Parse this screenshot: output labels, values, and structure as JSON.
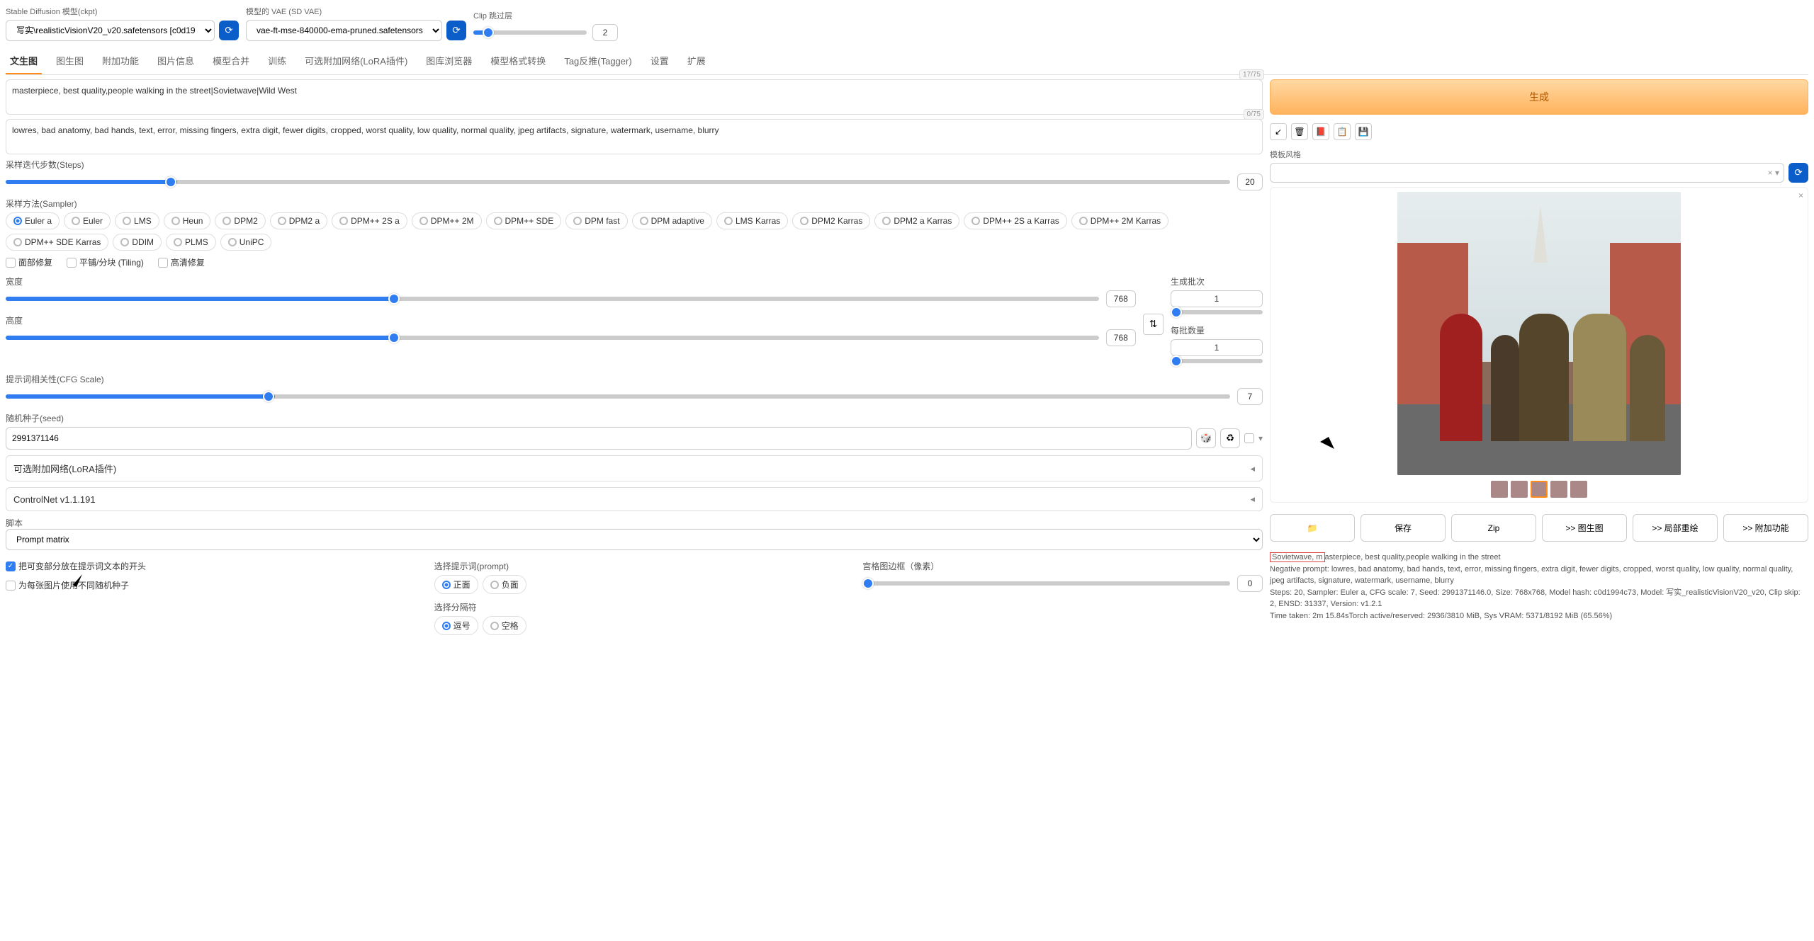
{
  "top": {
    "model_label": "Stable Diffusion 模型(ckpt)",
    "model_value": "写实\\realisticVisionV20_v20.safetensors [c0d19",
    "vae_label": "模型的 VAE (SD VAE)",
    "vae_value": "vae-ft-mse-840000-ema-pruned.safetensors",
    "clip_label": "Clip 跳过层",
    "clip_value": "2"
  },
  "tabs": [
    "文生图",
    "图生图",
    "附加功能",
    "图片信息",
    "模型合并",
    "训练",
    "可选附加网络(LoRA插件)",
    "图库浏览器",
    "模型格式转换",
    "Tag反推(Tagger)",
    "设置",
    "扩展"
  ],
  "active_tab": 0,
  "prompt": {
    "positive": "masterpiece, best quality,people walking in the street|Sovietwave|Wild West",
    "positive_counter": "17/75",
    "negative": "lowres, bad anatomy, bad hands, text, error, missing fingers, extra digit, fewer digits, cropped, worst quality, low quality, normal quality, jpeg artifacts, signature, watermark, username, blurry",
    "negative_counter": "0/75"
  },
  "generate_label": "生成",
  "style_label": "模板风格",
  "params": {
    "steps_label": "采样迭代步数(Steps)",
    "steps_value": "20",
    "sampler_label": "采样方法(Sampler)",
    "samplers": [
      "Euler a",
      "Euler",
      "LMS",
      "Heun",
      "DPM2",
      "DPM2 a",
      "DPM++ 2S a",
      "DPM++ 2M",
      "DPM++ SDE",
      "DPM fast",
      "DPM adaptive",
      "LMS Karras",
      "DPM2 Karras",
      "DPM2 a Karras",
      "DPM++ 2S a Karras",
      "DPM++ 2M Karras",
      "DPM++ SDE Karras",
      "DDIM",
      "PLMS",
      "UniPC"
    ],
    "sampler_selected": "Euler a",
    "face_restore": "面部修复",
    "tiling": "平铺/分块 (Tiling)",
    "hires": "高清修复",
    "width_label": "宽度",
    "width_value": "768",
    "height_label": "高度",
    "height_value": "768",
    "batch_count_label": "生成批次",
    "batch_count_value": "1",
    "batch_size_label": "每批数量",
    "batch_size_value": "1",
    "cfg_label": "提示词相关性(CFG Scale)",
    "cfg_value": "7",
    "seed_label": "随机种子(seed)",
    "seed_value": "2991371146",
    "lora_label": "可选附加网络(LoRA插件)",
    "controlnet_label": "ControlNet v1.1.191",
    "script_label": "脚本",
    "script_value": "Prompt matrix"
  },
  "prompt_matrix": {
    "opt1": "把可变部分放在提示词文本的开头",
    "opt2": "为每张图片使用不同随机种子",
    "select_prompt_label": "选择提示词(prompt)",
    "positive": "正面",
    "negative": "负面",
    "sep_label": "选择分隔符",
    "comma": "逗号",
    "space": "空格",
    "margin_label": "宫格图边框（像素）",
    "margin_value": "0"
  },
  "actions": {
    "folder": "📁",
    "save": "保存",
    "zip": "Zip",
    "to_img2img": ">> 图生图",
    "to_inpaint": ">> 局部重绘",
    "to_extras": ">> 附加功能"
  },
  "info": {
    "line1_hl": "Sovietwave, m",
    "line1_rest": "asterpiece, best quality,people walking in the street",
    "line2": "Negative prompt: lowres, bad anatomy, bad hands, text, error, missing fingers, extra digit, fewer digits, cropped, worst quality, low quality, normal quality, jpeg artifacts, signature, watermark, username, blurry",
    "line3": "Steps: 20, Sampler: Euler a, CFG scale: 7, Seed: 2991371146.0, Size: 768x768, Model hash: c0d1994c73, Model: 写实_realisticVisionV20_v20, Clip skip: 2, ENSD: 31337, Version: v1.2.1",
    "line4": "Time taken: 2m 15.84sTorch active/reserved: 2936/3810 MiB, Sys VRAM: 5371/8192 MiB (65.56%)"
  }
}
